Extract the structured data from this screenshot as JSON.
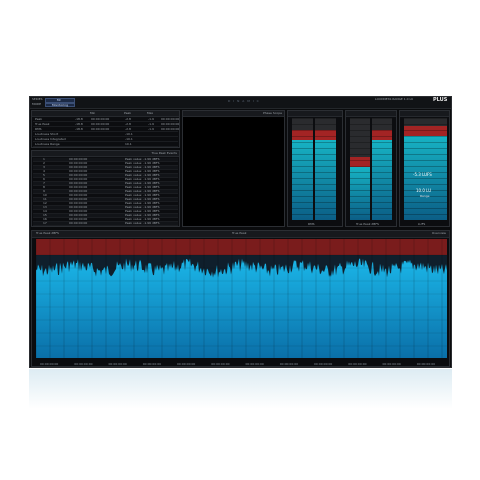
{
  "app": {
    "brand": "D I N A M I C",
    "logo_text": "PLUS",
    "topbar_left": [
      "SERIES",
      "MODE"
    ],
    "mode_tab_label": "Mr",
    "mode_tab2_label": "Monitoring",
    "topbar_right_info": "LOUDNESS RANGE 1.0 LU"
  },
  "stats_table": {
    "headers": [
      "",
      "Min",
      "Peak",
      "Max"
    ],
    "rows": [
      [
        "Peak",
        "-18.8",
        "00:00:00:00",
        "-2.8",
        "-1.9",
        "00:00:00:00"
      ],
      [
        "True Peak",
        "-18.8",
        "00:00:00:00",
        "-2.8",
        "-1.9",
        "00:00:00:00"
      ],
      [
        "RMS",
        "-18.8",
        "00:00:00:00",
        "-2.8",
        "-1.9",
        "00:00:00:00"
      ],
      [
        "Loudness Short",
        "",
        "",
        "-10.1",
        "",
        ""
      ],
      [
        "Loudness Integrated",
        "",
        "",
        "-10.1",
        "",
        ""
      ],
      [
        "Loudness Range",
        "",
        "",
        "10.1",
        "",
        ""
      ]
    ]
  },
  "event_list": {
    "header": "True Peak Events",
    "rows": [
      [
        "1",
        "00:00:00:00",
        "Peak value: -1.96 dBFS"
      ],
      [
        "2",
        "00:00:00:00",
        "Peak value: -1.96 dBFS"
      ],
      [
        "3",
        "00:00:00:00",
        "Peak value: -1.96 dBFS"
      ],
      [
        "4",
        "00:00:00:00",
        "Peak value: -1.96 dBFS"
      ],
      [
        "5",
        "00:00:00:00",
        "Peak value: -1.96 dBFS"
      ],
      [
        "6",
        "00:00:00:00",
        "Peak value: -1.96 dBFS"
      ],
      [
        "7",
        "00:00:00:00",
        "Peak value: -1.96 dBFS"
      ],
      [
        "8",
        "00:00:00:00",
        "Peak value: -1.96 dBFS"
      ],
      [
        "9",
        "00:00:00:00",
        "Peak value: -1.96 dBFS"
      ],
      [
        "10",
        "00:00:00:00",
        "Peak value: -1.96 dBFS"
      ],
      [
        "11",
        "00:00:00:00",
        "Peak value: -1.96 dBFS"
      ],
      [
        "12",
        "00:00:00:00",
        "Peak value: -1.96 dBFS"
      ],
      [
        "13",
        "00:00:00:00",
        "Peak value: -1.96 dBFS"
      ],
      [
        "14",
        "00:00:00:00",
        "Peak value: -1.96 dBFS"
      ],
      [
        "15",
        "00:00:00:00",
        "Peak value: -1.96 dBFS"
      ],
      [
        "16",
        "00:00:00:00",
        "Peak value: -1.96 dBFS"
      ],
      [
        "17",
        "00:00:00:00",
        "Peak value: -1.96 dBFS"
      ]
    ]
  },
  "scope": {
    "title": "Phase Scope"
  },
  "meters": {
    "meter1_label": "RMS",
    "meter2_label": "True Peak dBFS",
    "meter3_label": "LUFS",
    "readout_value_1": "-5.3 LUFS",
    "readout_value_2": "10.0 LU",
    "readout_caption": "Range",
    "levels": {
      "m1_l": 0.88,
      "m1_r": 0.88,
      "m2_l": 0.62,
      "m2_r": 0.88,
      "m3": 0.92
    }
  },
  "timeline": {
    "title": "True Peak",
    "left_label": "True Peak dBFS",
    "right_label": "Overview",
    "time_ticks": [
      "00:00:00:00",
      "00:00:00:00",
      "00:00:00:00",
      "00:00:00:00",
      "00:00:00:00",
      "00:00:00:00",
      "00:00:00:00",
      "00:00:00:00",
      "00:00:00:00",
      "00:00:00:00",
      "00:00:00:00",
      "00:00:00:00"
    ]
  },
  "colors": {
    "accent": "#0fa0d8",
    "alert": "#9c2020",
    "panel_bg": "#0c0d10"
  }
}
